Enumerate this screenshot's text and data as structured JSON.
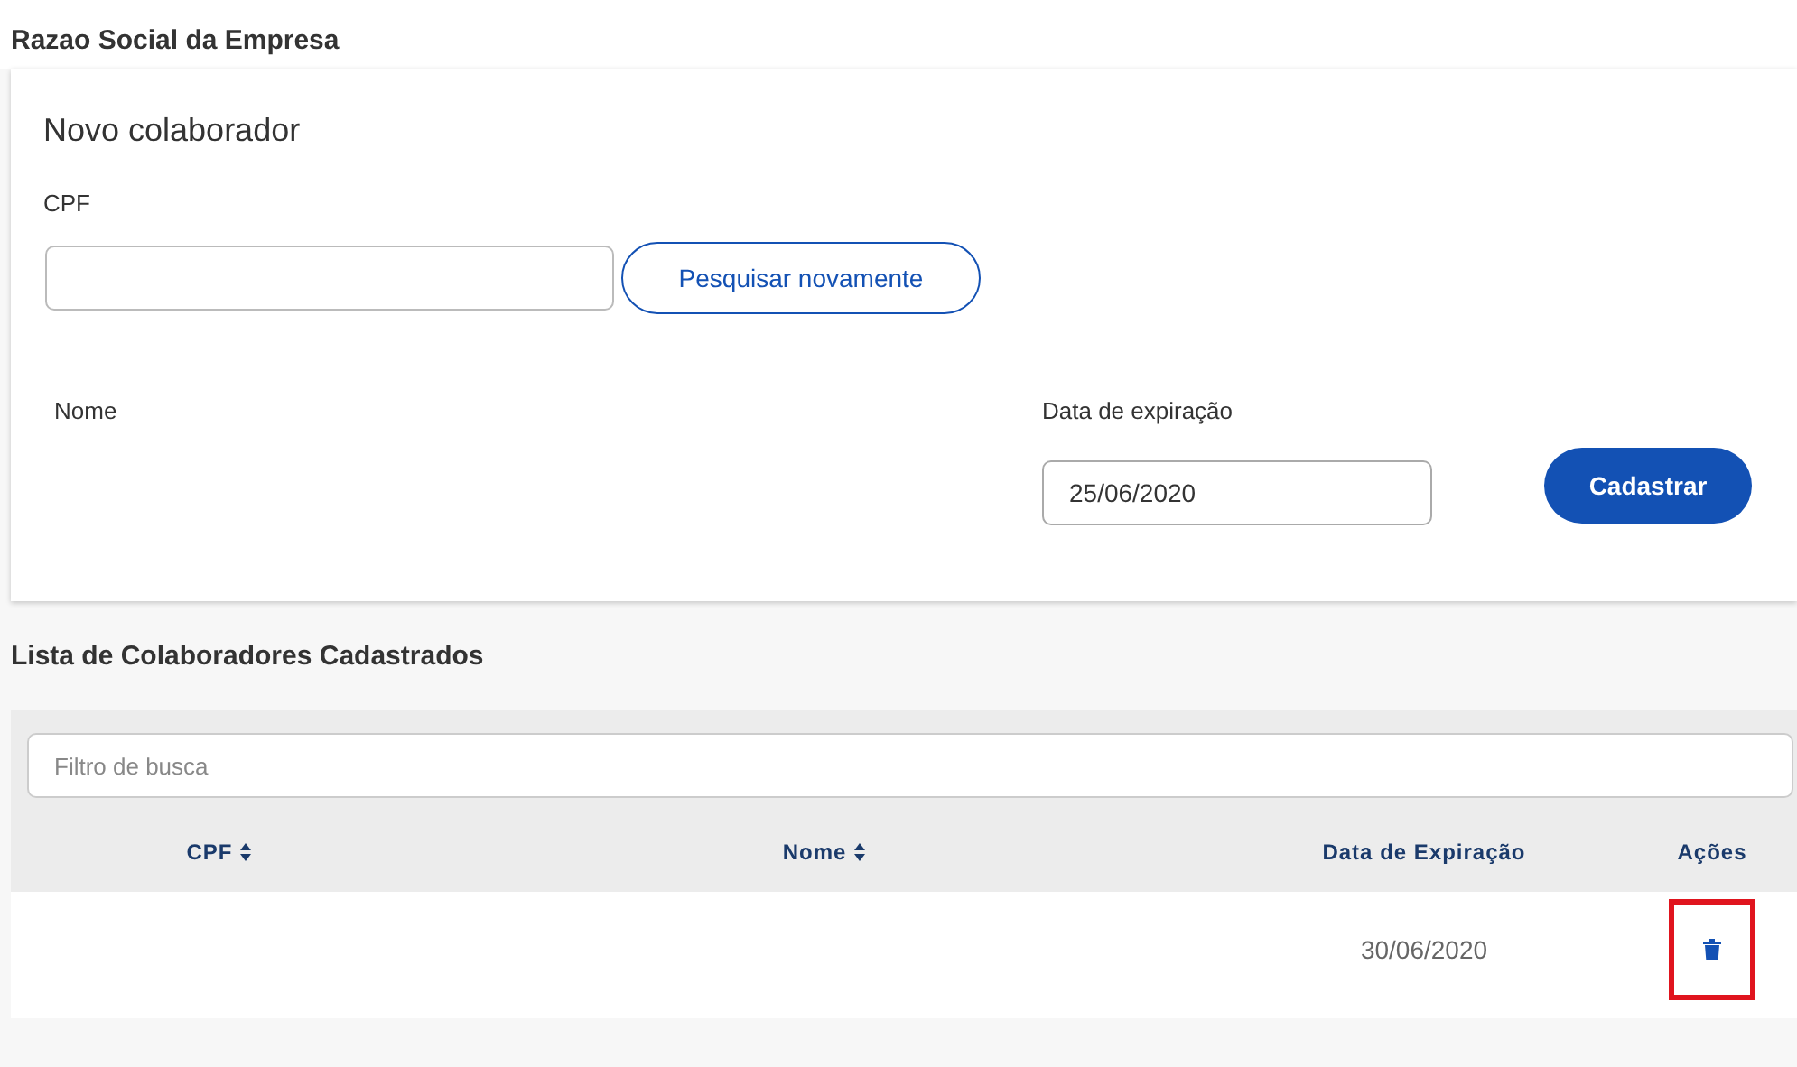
{
  "page_title": "Razao Social da Empresa",
  "form": {
    "title": "Novo colaborador",
    "cpf_label": "CPF",
    "search_button": "Pesquisar novamente",
    "name_label": "Nome",
    "date_label": "Data de expiração",
    "date_value": "25/06/2020",
    "submit_button": "Cadastrar"
  },
  "list": {
    "title": "Lista de Colaboradores Cadastrados",
    "filter": {
      "placeholder": "Filtro de busca"
    },
    "columns": [
      {
        "label": "CPF",
        "sortable": true
      },
      {
        "label": "Nome",
        "sortable": true
      },
      {
        "label": "Data de Expiração",
        "sortable": false
      },
      {
        "label": "Ações",
        "sortable": false
      }
    ],
    "rows": [
      {
        "data": "30/06/2020",
        "delete_highlighted": true
      }
    ]
  }
}
